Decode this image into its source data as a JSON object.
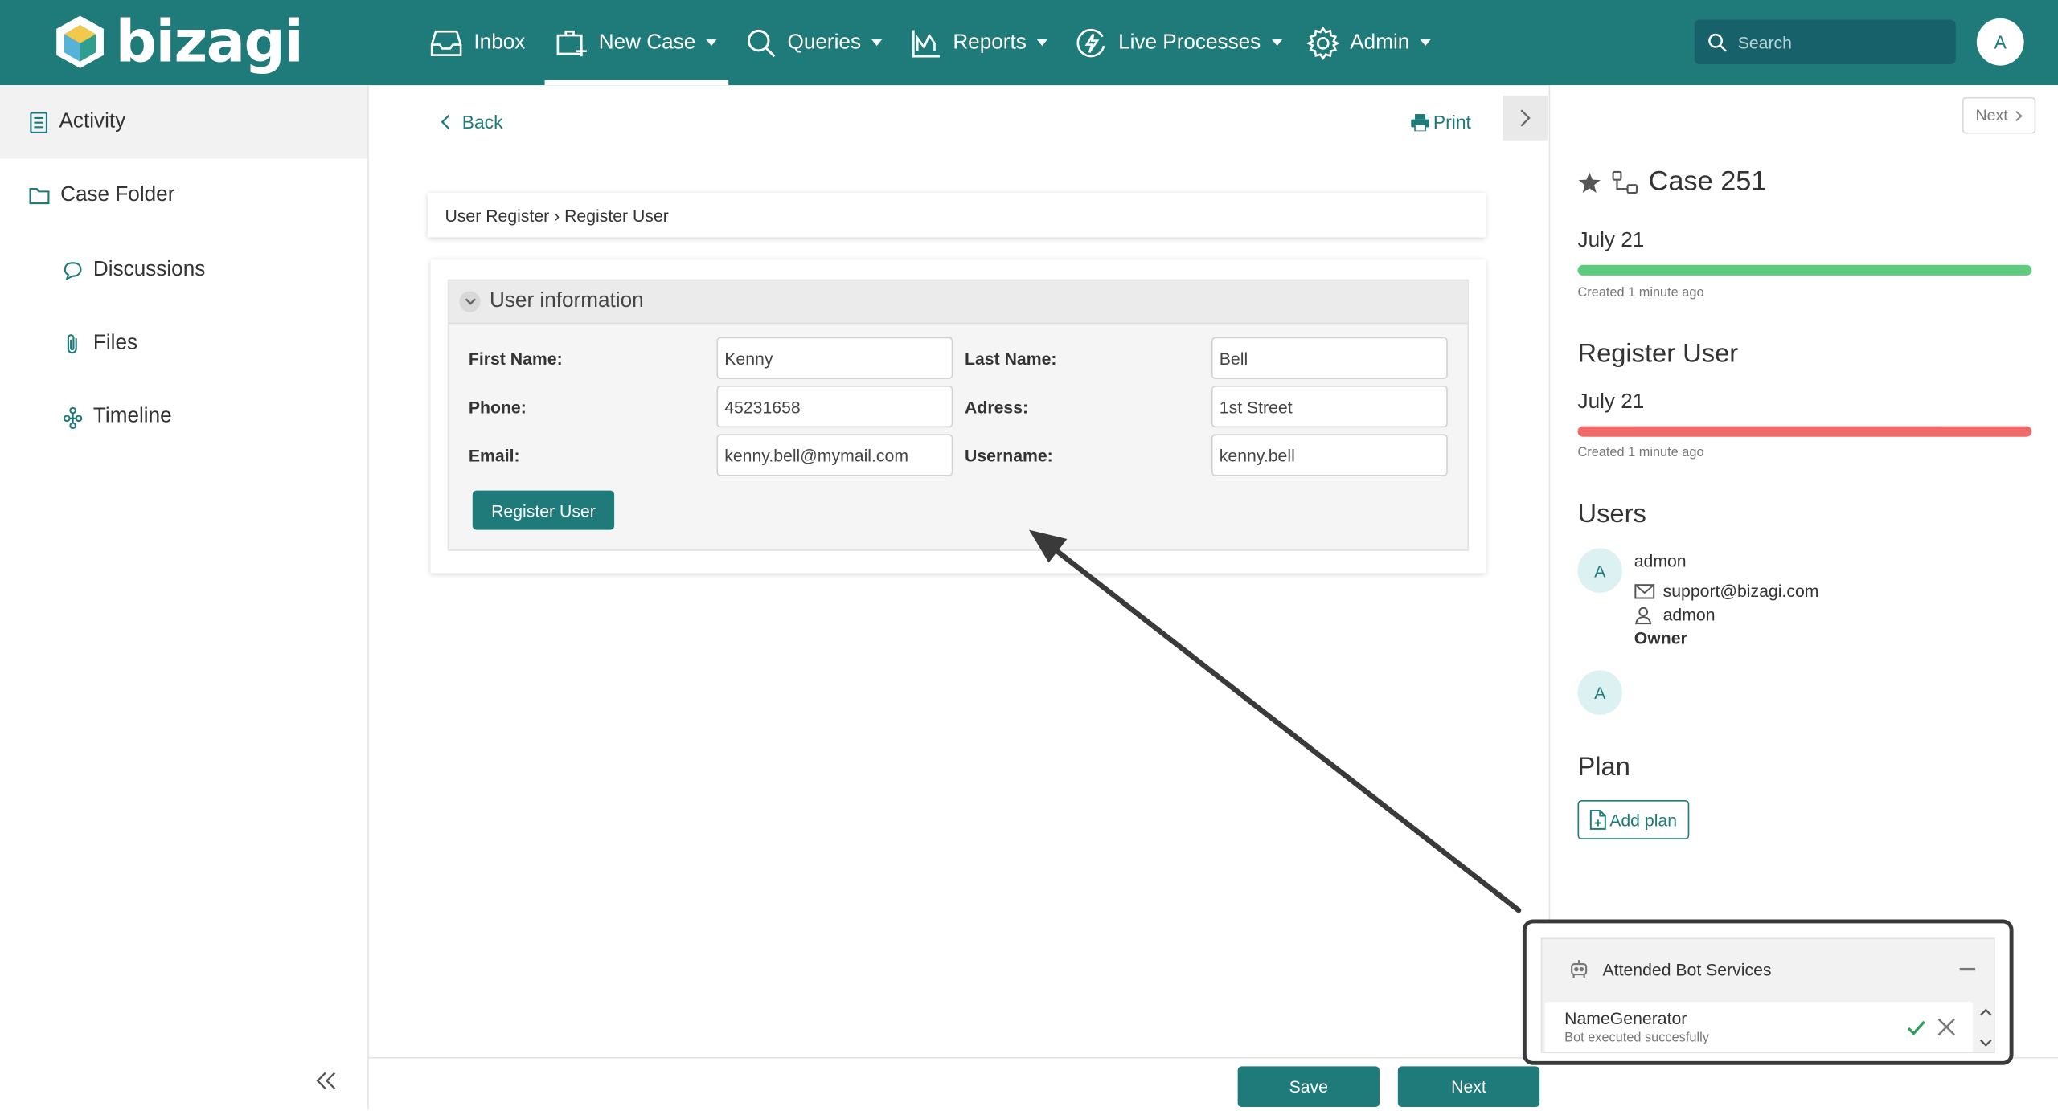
{
  "app": {
    "logo_text": "bizagi",
    "brand_color": "#1f7a7a"
  },
  "nav": {
    "items": [
      {
        "label": "Inbox",
        "icon": "inbox-icon"
      },
      {
        "label": "New Case",
        "icon": "new-case-icon"
      },
      {
        "label": "Queries",
        "icon": "search-icon"
      },
      {
        "label": "Reports",
        "icon": "chart-icon"
      },
      {
        "label": "Live Processes",
        "icon": "lightning-icon"
      },
      {
        "label": "Admin",
        "icon": "gear-icon"
      }
    ],
    "search_placeholder": "Search",
    "avatar_letter": "A"
  },
  "sidebar": {
    "items": [
      {
        "label": "Activity",
        "icon": "activity-icon"
      },
      {
        "label": "Case Folder",
        "icon": "folder-icon"
      },
      {
        "label": "Discussions",
        "icon": "chat-icon"
      },
      {
        "label": "Files",
        "icon": "paperclip-icon"
      },
      {
        "label": "Timeline",
        "icon": "timeline-icon"
      }
    ]
  },
  "main": {
    "back_label": "Back",
    "print_label": "Print",
    "breadcrumb": "User Register › Register User",
    "group_title": "User information",
    "fields": {
      "first_name": {
        "label": "First Name:",
        "value": "Kenny"
      },
      "last_name": {
        "label": "Last Name:",
        "value": "Bell"
      },
      "phone": {
        "label": "Phone:",
        "value": "45231658"
      },
      "address": {
        "label": "Adress:",
        "value": "1st Street"
      },
      "email": {
        "label": "Email:",
        "value": "kenny.bell@mymail.com"
      },
      "username": {
        "label": "Username:",
        "value": "kenny.bell"
      }
    },
    "register_button": "Register User"
  },
  "footer": {
    "save_label": "Save",
    "next_label": "Next"
  },
  "right_panel": {
    "next_label": "Next",
    "case_title": "Case 251",
    "case_date": "July 21",
    "case_progress_color": "#5fcb7f",
    "case_created": "Created 1 minute ago",
    "task_title": "Register User",
    "task_date": "July 21",
    "task_progress_color": "#f06a6a",
    "task_created": "Created 1 minute ago",
    "users_title": "Users",
    "user": {
      "avatar": "A",
      "name": "admon",
      "email": "support@bizagi.com",
      "username": "admon",
      "role": "Owner"
    },
    "second_avatar": "A",
    "plan_title": "Plan",
    "add_plan_label": "Add plan"
  },
  "bot_panel": {
    "title": "Attended Bot Services",
    "bot_name": "NameGenerator",
    "bot_status": "Bot executed succesfully"
  }
}
